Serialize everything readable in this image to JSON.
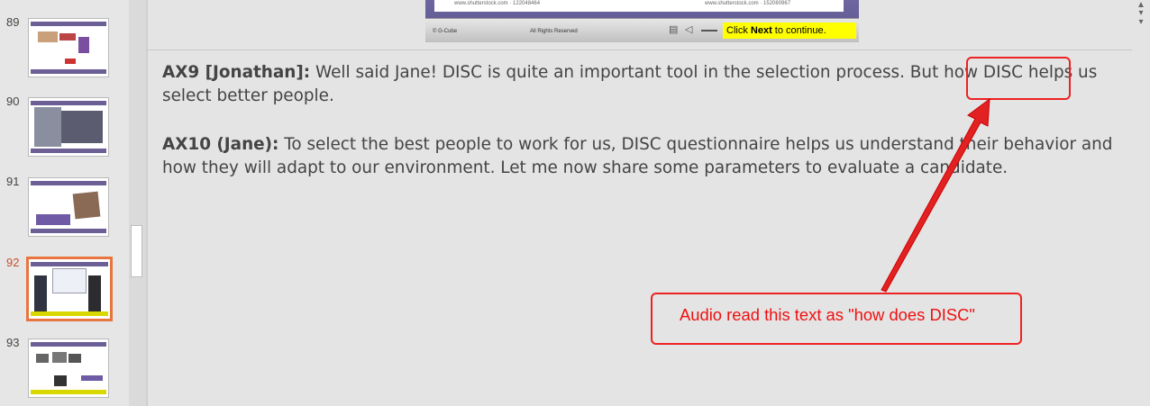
{
  "slides_pane": {
    "thumbnails": [
      {
        "number": "89",
        "active": false
      },
      {
        "number": "90",
        "active": false
      },
      {
        "number": "91",
        "active": false
      },
      {
        "number": "92",
        "active": true
      },
      {
        "number": "93",
        "active": false
      }
    ]
  },
  "slide_preview": {
    "credit_left": "www.shutterstock.com · 122048464",
    "credit_right": "www.shutterstock.com · 152080967",
    "brand": "© G-Cube",
    "rights": "All Rights Reserved",
    "next_prefix": "Click ",
    "next_bold": "Next",
    "next_suffix": " to continue."
  },
  "notes": [
    {
      "speaker": "AX9 [Jonathan]:",
      "text": " Well said Jane! DISC is quite an important tool in the selection process. But how DISC helps us select better people."
    },
    {
      "speaker": "AX10 (Jane):",
      "text": " To select the best people to work for us, DISC questionnaire helps us understand their behavior and how they will adapt to our environment. Let me now share some parameters to evaluate a candidate."
    }
  ],
  "annotation": {
    "callout_text": "Audio read this text as \"how does DISC\"",
    "color": "#e22222"
  },
  "icons": {
    "scroll_up": "scroll-up-arrow-icon",
    "scroll_down": "scroll-down-arrow-icon"
  }
}
